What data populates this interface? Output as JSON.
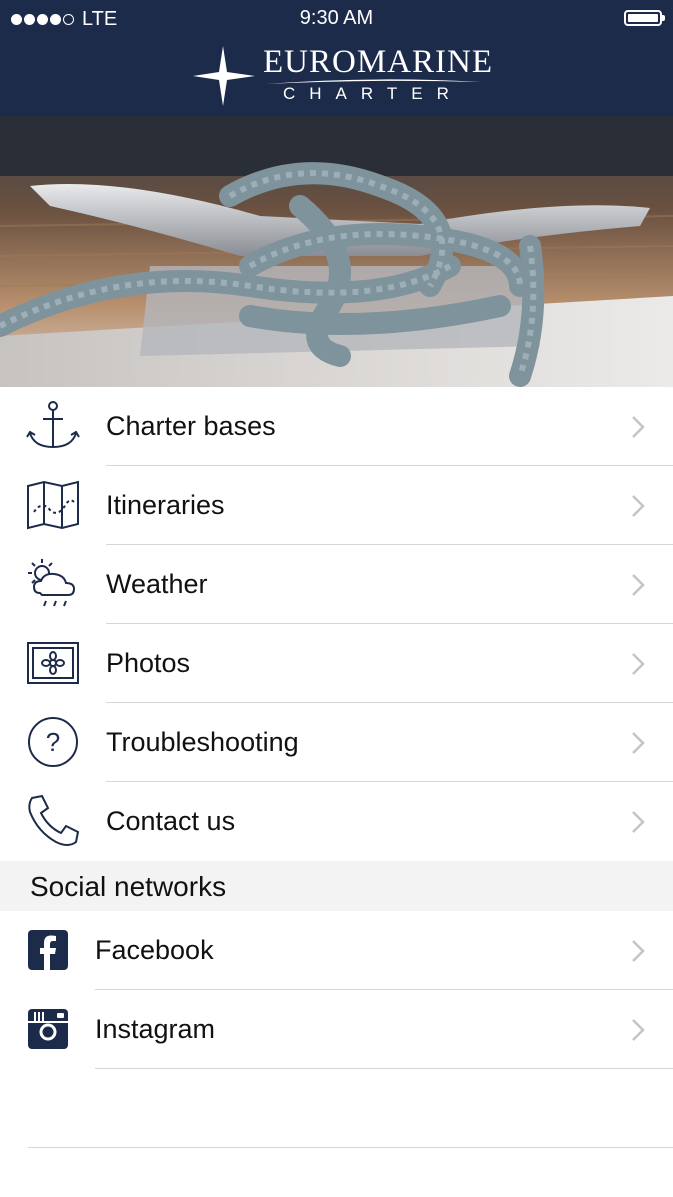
{
  "status_bar": {
    "carrier": "LTE",
    "time": "9:30 AM"
  },
  "header": {
    "brand_line1": "EUROMARINE",
    "brand_line2": "CHARTER"
  },
  "menu": [
    {
      "label": "Charter bases",
      "icon": "anchor-icon"
    },
    {
      "label": "Itineraries",
      "icon": "map-icon"
    },
    {
      "label": "Weather",
      "icon": "weather-icon"
    },
    {
      "label": "Photos",
      "icon": "photos-icon"
    },
    {
      "label": "Troubleshooting",
      "icon": "question-icon"
    },
    {
      "label": "Contact us",
      "icon": "phone-icon"
    }
  ],
  "social": {
    "title": "Social networks",
    "items": [
      {
        "label": "Facebook",
        "icon": "facebook-icon"
      },
      {
        "label": "Instagram",
        "icon": "instagram-icon"
      }
    ]
  },
  "colors": {
    "navy": "#1d2b4b",
    "separator": "#d7d7d7",
    "section_bg": "#f3f3f3"
  }
}
